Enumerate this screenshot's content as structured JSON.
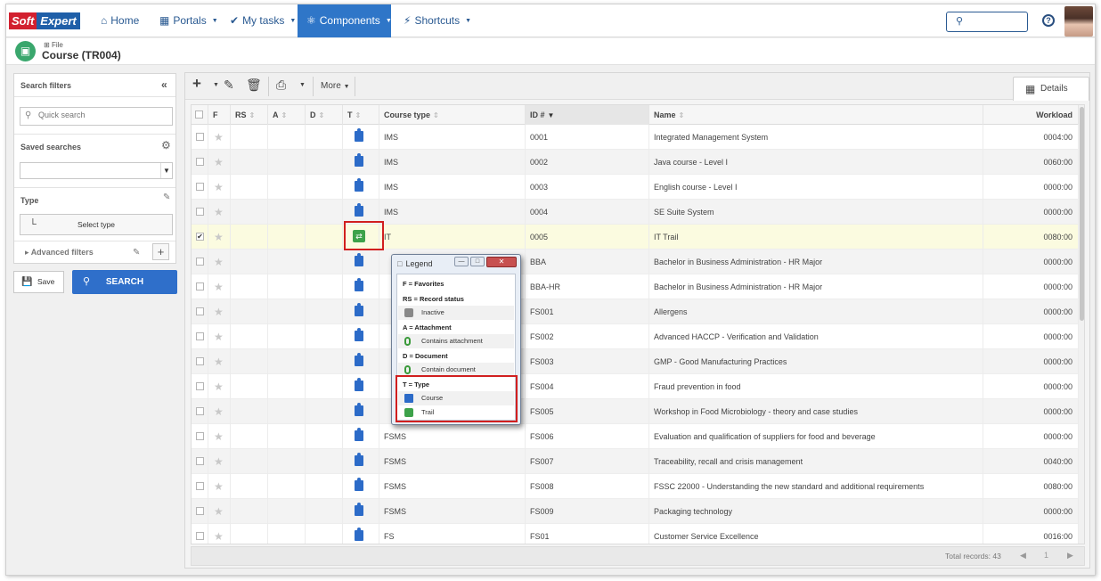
{
  "brand": {
    "left": "Soft",
    "right": "Expert"
  },
  "nav": [
    {
      "label": "Home",
      "icon": "home-icon"
    },
    {
      "label": "Portals",
      "icon": "portals-icon"
    },
    {
      "label": "My tasks",
      "icon": "check-icon"
    },
    {
      "label": "Components",
      "icon": "trophy-icon",
      "active": true
    },
    {
      "label": "Shortcuts",
      "icon": "bolt-icon"
    }
  ],
  "header": {
    "file_label": "File",
    "title": "Course (TR004)"
  },
  "filters": {
    "title": "Search filters",
    "quick_search_placeholder": "Quick search",
    "saved_searches": "Saved searches",
    "type": "Type",
    "select_type": "Select type",
    "advanced": "Advanced filters",
    "save": "Save",
    "search": "SEARCH"
  },
  "toolbar": {
    "more": "More",
    "details": "Details"
  },
  "columns": {
    "f": "F",
    "rs": "RS",
    "a": "A",
    "d": "D",
    "t": "T",
    "course_type": "Course type",
    "id": "ID #",
    "name": "Name",
    "workload": "Workload"
  },
  "rows": [
    {
      "course_type": "IMS",
      "id": "0001",
      "name": "Integrated Management System",
      "workload": "0004:00",
      "type": "course",
      "checked": false
    },
    {
      "course_type": "IMS",
      "id": "0002",
      "name": "Java course - Level I",
      "workload": "0060:00",
      "type": "course",
      "checked": false
    },
    {
      "course_type": "IMS",
      "id": "0003",
      "name": "English course - Level I",
      "workload": "0000:00",
      "type": "course",
      "checked": false
    },
    {
      "course_type": "IMS",
      "id": "0004",
      "name": "SE Suite System",
      "workload": "0000:00",
      "type": "course",
      "checked": false
    },
    {
      "course_type": "IT",
      "id": "0005",
      "name": "IT Trail",
      "workload": "0080:00",
      "type": "trail",
      "checked": true
    },
    {
      "course_type": "",
      "id": "BBA",
      "name": "Bachelor in Business Administration - HR Major",
      "workload": "0000:00",
      "type": "course",
      "checked": false
    },
    {
      "course_type": "",
      "id": "BBA-HR",
      "name": "Bachelor in Business Administration - HR Major",
      "workload": "0000:00",
      "type": "course",
      "checked": false
    },
    {
      "course_type": "",
      "id": "FS001",
      "name": "Allergens",
      "workload": "0000:00",
      "type": "course",
      "checked": false
    },
    {
      "course_type": "",
      "id": "FS002",
      "name": "Advanced HACCP - Verification and Validation",
      "workload": "0000:00",
      "type": "course",
      "checked": false
    },
    {
      "course_type": "",
      "id": "FS003",
      "name": "GMP - Good Manufacturing Practices",
      "workload": "0000:00",
      "type": "course",
      "checked": false
    },
    {
      "course_type": "",
      "id": "FS004",
      "name": "Fraud prevention in food",
      "workload": "0000:00",
      "type": "course",
      "checked": false
    },
    {
      "course_type": "",
      "id": "FS005",
      "name": "Workshop in Food Microbiology - theory and case studies",
      "workload": "0000:00",
      "type": "course",
      "checked": false
    },
    {
      "course_type": "FSMS",
      "id": "FS006",
      "name": "Evaluation and qualification of suppliers for food and beverage",
      "workload": "0000:00",
      "type": "course",
      "checked": false
    },
    {
      "course_type": "FSMS",
      "id": "FS007",
      "name": "Traceability, recall and crisis management",
      "workload": "0040:00",
      "type": "course",
      "checked": false
    },
    {
      "course_type": "FSMS",
      "id": "FS008",
      "name": "FSSC 22000 - Understanding the new standard and additional requirements",
      "workload": "0080:00",
      "type": "course",
      "checked": false
    },
    {
      "course_type": "FSMS",
      "id": "FS009",
      "name": "Packaging technology",
      "workload": "0000:00",
      "type": "course",
      "checked": false
    },
    {
      "course_type": "FS",
      "id": "FS01",
      "name": "Customer Service Excellence",
      "workload": "0016:00",
      "type": "course",
      "checked": false
    }
  ],
  "footer": {
    "total": "Total records: 43",
    "page": "1"
  },
  "legend": {
    "title": "Legend",
    "favorites": "F = Favorites",
    "record_status": "RS = Record status",
    "inactive": "Inactive",
    "attachment": "A = Attachment",
    "contains_attachment": "Contains attachment",
    "document": "D = Document",
    "contain_document": "Contain document",
    "type": "T = Type",
    "course": "Course",
    "trail": "Trail"
  },
  "colors": {
    "accent": "#2f76c8",
    "highlight": "#d11f1f",
    "course_icon": "#2c6bc8",
    "trail_icon": "#3da24a"
  }
}
